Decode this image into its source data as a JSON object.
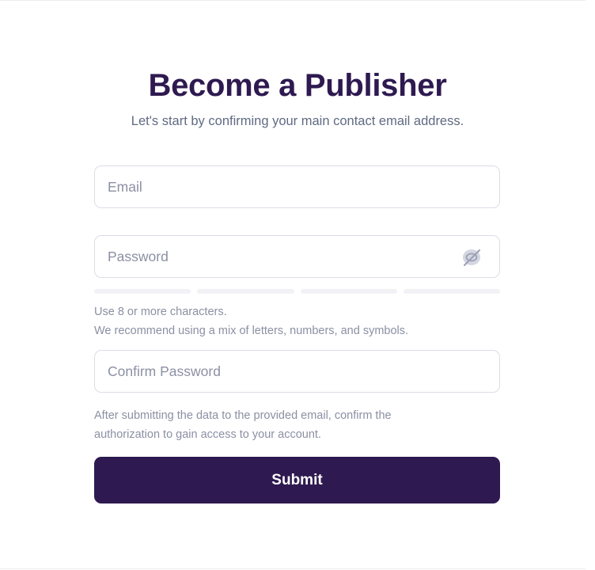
{
  "form": {
    "title": "Become a Publisher",
    "subtitle": "Let's start by confirming your main contact email address.",
    "email": {
      "placeholder": "Email",
      "value": ""
    },
    "password": {
      "placeholder": "Password",
      "value": "",
      "toggle_icon": "eye-slash-icon"
    },
    "password_strength": {
      "segments": 4,
      "filled": 0
    },
    "password_hint": [
      "Use 8 or more characters.",
      "We recommend using a mix of letters, numbers, and symbols."
    ],
    "confirm_password": {
      "placeholder": "Confirm Password",
      "value": ""
    },
    "confirm_hint": [
      "After submitting the data to the provided email, confirm the",
      "authorization to gain access to your account."
    ],
    "submit_label": "Submit"
  },
  "colors": {
    "brand": "#2e1a50",
    "muted_text": "#8b90a3",
    "subtitle_text": "#5f6a82",
    "border": "#dcdde6"
  }
}
